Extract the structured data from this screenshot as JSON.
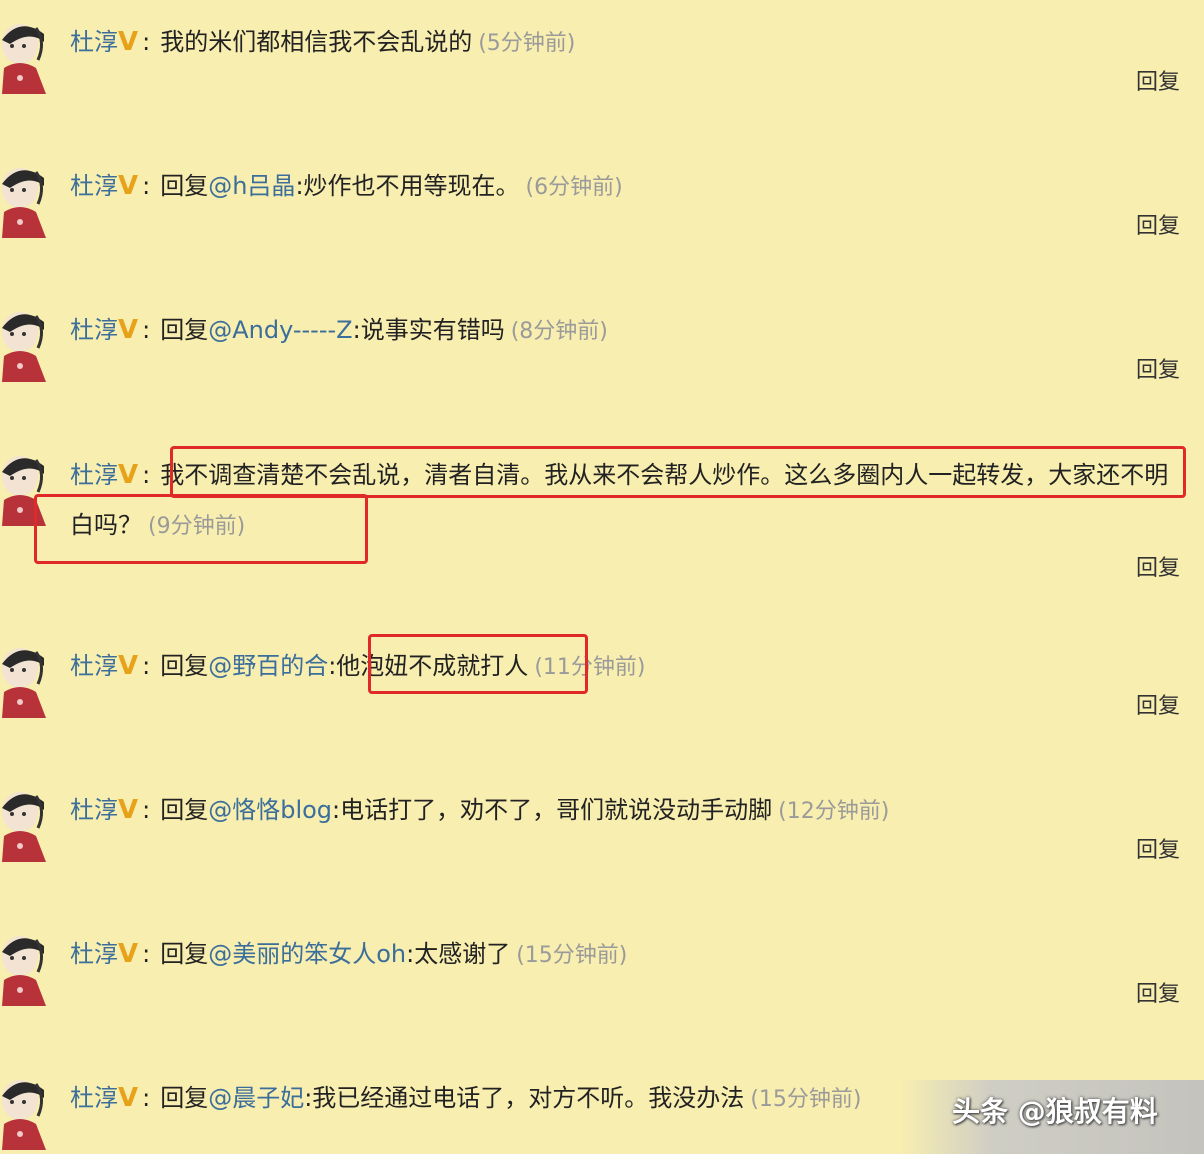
{
  "author": "杜淳",
  "reply_label": "回复",
  "comments": [
    {
      "prefix": "",
      "mention": "",
      "text": "我的米们都相信我不会乱说的",
      "time": "(5分钟前)"
    },
    {
      "prefix": "回复",
      "mention": "@h吕晶",
      "text": ":炒作也不用等现在。",
      "time": "(6分钟前)"
    },
    {
      "prefix": "回复",
      "mention": "@Andy-----Z",
      "text": ":说事实有错吗",
      "time": "(8分钟前)"
    },
    {
      "prefix": "",
      "mention": "",
      "text": "我不调查清楚不会乱说，清者自清。我从来不会帮人炒作。这么多圈内人一起转发，大家还不明白吗？",
      "time": "(9分钟前)"
    },
    {
      "prefix": "回复",
      "mention": "@野百的合",
      "text": ":他泡妞不成就打人",
      "time": "(11分钟前)"
    },
    {
      "prefix": "回复",
      "mention": "@恪恪blog",
      "text": ":电话打了，劝不了，哥们就说没动手动脚",
      "time": "(12分钟前)"
    },
    {
      "prefix": "回复",
      "mention": "@美丽的笨女人oh",
      "text": ":太感谢了",
      "time": "(15分钟前)"
    },
    {
      "prefix": "回复",
      "mention": "@晨子妃",
      "text": ":我已经通过电话了，对方不听。我没办法",
      "time": "(15分钟前)"
    }
  ],
  "watermark": "头条 @狼叔有料",
  "colors": {
    "background": "#f8eeb0",
    "author": "#3b6e9a",
    "highlight": "#e02a2a",
    "badge": "#e8a21a"
  }
}
